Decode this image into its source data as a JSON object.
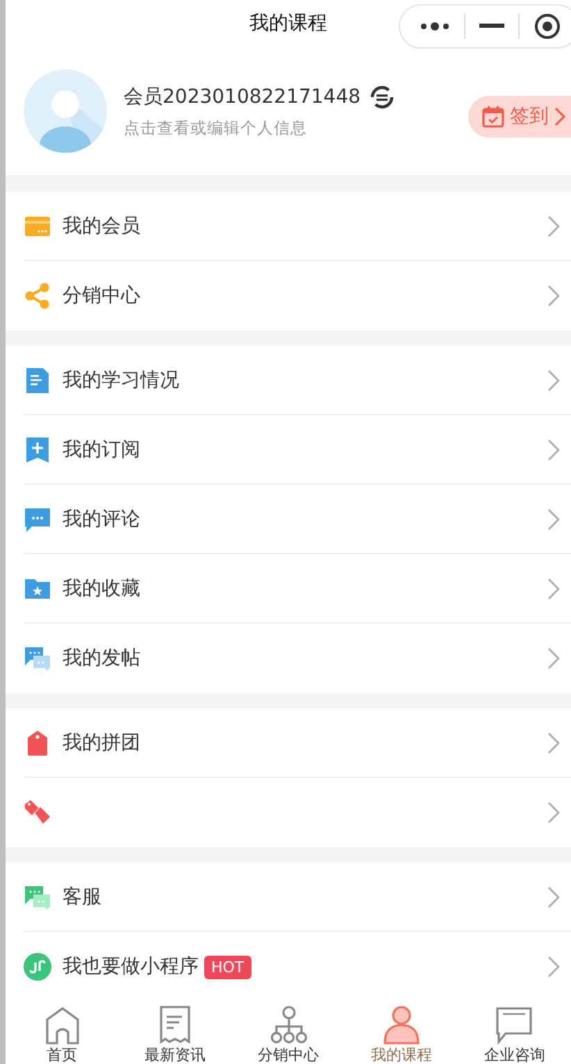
{
  "window": {
    "title": "我的课程"
  },
  "profile": {
    "name": "会员2023010822171448",
    "hint": "点击查看或编辑个人信息",
    "signin": "签到"
  },
  "sections": [
    {
      "items": [
        {
          "kind": "card",
          "label": "我的会员"
        },
        {
          "kind": "share",
          "label": "分销中心"
        }
      ]
    },
    {
      "items": [
        {
          "kind": "document",
          "label": "我的学习情况"
        },
        {
          "kind": "bookmark",
          "label": "我的订阅"
        },
        {
          "kind": "comment",
          "label": "我的评论"
        },
        {
          "kind": "folder",
          "label": "我的收藏"
        },
        {
          "kind": "posts",
          "label": "我的发帖"
        }
      ]
    },
    {
      "items": [
        {
          "kind": "tag",
          "label": "我的拼团"
        },
        {
          "kind": "tags"
        }
      ]
    },
    {
      "items": [
        {
          "kind": "service",
          "label": "客服"
        },
        {
          "kind": "miniapp",
          "label": "我也要做小程序",
          "badge": "HOT"
        }
      ]
    }
  ],
  "tabbar": [
    {
      "label": "首页",
      "selected": false
    },
    {
      "label": "最新资讯",
      "selected": false
    },
    {
      "label": "分销中心",
      "selected": false
    },
    {
      "label": "我的课程",
      "selected": true
    },
    {
      "label": "企业咨询",
      "selected": false
    }
  ]
}
